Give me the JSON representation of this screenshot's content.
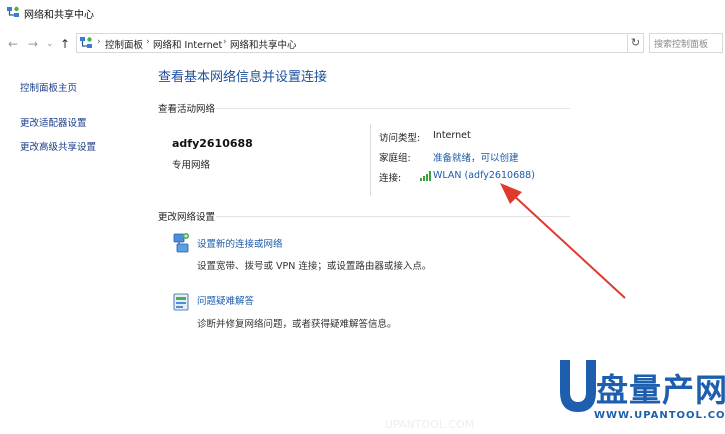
{
  "window": {
    "title": "网络和共享中心"
  },
  "address": {
    "nav": {
      "back": "←",
      "forward": "→",
      "recent": "⌄",
      "up": "↑"
    },
    "crumbs": [
      "控制面板",
      "网络和 Internet",
      "网络和共享中心"
    ],
    "separator": "›",
    "dropdown": "⌄",
    "refresh": "↻",
    "search_placeholder": "搜索控制面板"
  },
  "sidebar": {
    "items": [
      {
        "label": "控制面板主页"
      },
      {
        "label": "更改适配器设置"
      },
      {
        "label": "更改高级共享设置"
      }
    ]
  },
  "main": {
    "heading": "查看基本网络信息并设置连接",
    "active_section": "查看活动网络",
    "network": {
      "name": "adfy2610688",
      "type": "专用网络",
      "access_label": "访问类型:",
      "access_value": "Internet",
      "homegroup_label": "家庭组:",
      "homegroup_value": "准备就绪，可以创建",
      "connection_label": "连接:",
      "connection_value": "WLAN (adfy2610688)"
    },
    "change_section": "更改网络设置",
    "tasks": [
      {
        "title": "设置新的连接或网络",
        "desc": "设置宽带、拨号或 VPN 连接；或设置路由器或接入点。",
        "icon": "network-setup-icon"
      },
      {
        "title": "问题疑难解答",
        "desc": "诊断并修复网络问题，或者获得疑难解答信息。",
        "icon": "troubleshoot-icon"
      }
    ]
  },
  "watermark": {
    "brand": "盘量产网",
    "url": "WWW.UPANTOOL.COM",
    "faint": "UPANTOOL.COM"
  },
  "colors": {
    "link": "#1c5ba9",
    "heading": "#1d4f9c",
    "arrow": "#e03a2f",
    "logo": "#1d5fae"
  }
}
